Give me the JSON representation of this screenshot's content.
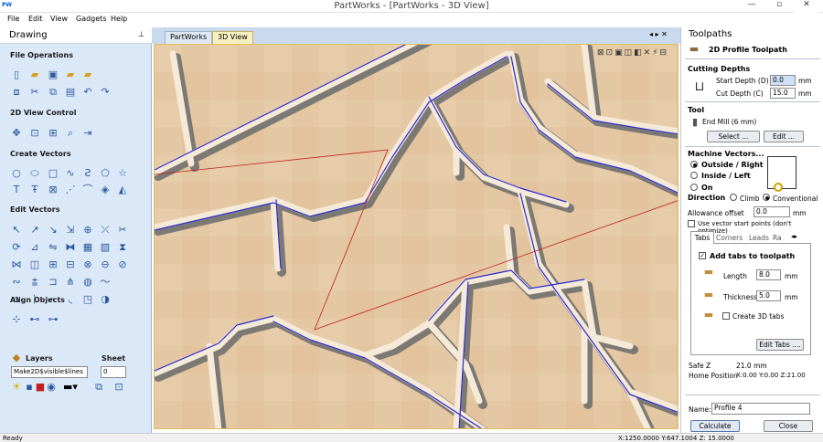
{
  "window": {
    "app_icon": "PW",
    "title": "PartWorks - [PartWorks - 3D View]",
    "min": "—",
    "restore": "▫",
    "close": "✕"
  },
  "menu": [
    "File",
    "Edit",
    "View",
    "Gadgets",
    "Help"
  ],
  "left": {
    "title": "Drawing",
    "sections": {
      "file_ops": "File Operations",
      "view_control": "2D View Control",
      "create_vectors": "Create Vectors",
      "edit_vectors": "Edit Vectors",
      "align_objects": "Align Objects"
    },
    "layers": {
      "label": "Layers",
      "sheet_label": "Sheet",
      "layer_value": "Make2D$visible$lines",
      "sheet_value": "0"
    }
  },
  "tabs": {
    "partworks": "PartWorks",
    "view3d": "3D View",
    "nav": "◂ ▸ ✕"
  },
  "right": {
    "title": "Toolpaths",
    "subtitle": "2D Profile Toolpath",
    "cutting_depths": "Cutting Depths",
    "start_depth_label": "Start Depth (D)",
    "start_depth_value": "0.0",
    "start_unit": "mm",
    "cut_depth_label": "Cut Depth (C)",
    "cut_depth_value": "15.0",
    "cut_unit": "mm",
    "tool": "Tool",
    "tool_name": "End Mill (6 mm)",
    "select_btn": "Select ...",
    "edit_btn": "Edit ...",
    "machine_vectors": "Machine Vectors...",
    "outside": "Outside / Right",
    "inside": "Inside / Left",
    "on": "On",
    "direction": "Direction",
    "climb": "Climb",
    "conventional": "Conventional",
    "allowance_label": "Allowance offset",
    "allowance_value": "0.0",
    "allowance_unit": "mm",
    "vector_start": "Use vector start points (don't optimize)",
    "subtabs": [
      "Tabs",
      "Corners",
      "Leads",
      "Ra"
    ],
    "add_tabs": "Add tabs to toolpath",
    "length_label": "Length",
    "length_value": "8.0",
    "length_unit": "mm",
    "thickness_label": "Thickness",
    "thickness_value": "5.0",
    "thickness_unit": "mm",
    "create3d": "Create 3D tabs",
    "edit_tabs_btn": "Edit Tabs ....",
    "safe_z": "Safe Z",
    "safe_z_value": "21.0 mm",
    "home_pos": "Home Position",
    "home_pos_value": "X:0.00 Y:0.00 Z:21.00",
    "name_label": "Name:",
    "name_value": "Profile 4",
    "calculate_btn": "Calculate",
    "close_btn": "Close"
  },
  "status": {
    "left": "Ready",
    "coords": "X:1250.0000 Y:647.1004 Z: 15.0000"
  }
}
